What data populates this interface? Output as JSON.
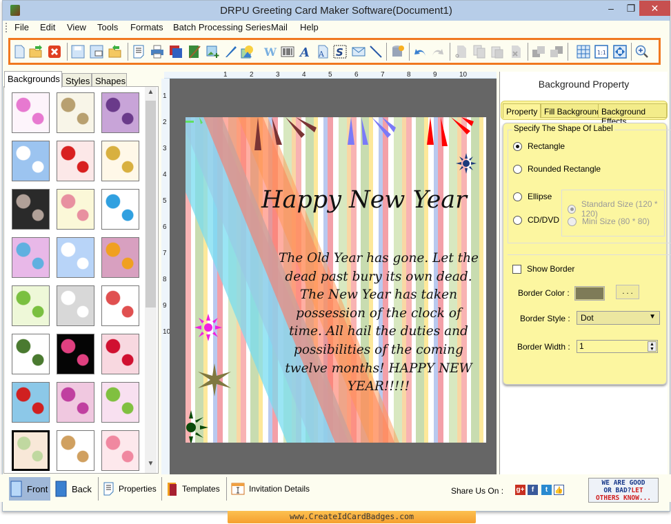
{
  "window": {
    "title": "DRPU Greeting Card Maker Software(Document1)",
    "controls": {
      "minimize": "‒",
      "maximize": "❐",
      "close": "✕"
    }
  },
  "menu": [
    "File",
    "Edit",
    "View",
    "Tools",
    "Formats",
    "Batch Processing Series",
    "Mail",
    "Help"
  ],
  "toolbar": {
    "tools": [
      "new",
      "open",
      "close",
      "save",
      "save-as",
      "export",
      "properties",
      "print",
      "background",
      "card-front",
      "insert-image",
      "pen",
      "shapes",
      "watermark",
      "barcode",
      "text",
      "word-art",
      "signature",
      "email",
      "line",
      "database",
      "undo",
      "redo",
      "cut",
      "copy",
      "paste",
      "delete",
      "bring-forward",
      "send-backward",
      "grid",
      "actual-size",
      "fit-to-window",
      "zoom-in"
    ]
  },
  "left_panel": {
    "tabs": [
      "Backgrounds",
      "Styles",
      "Shapes"
    ],
    "active_tab": "Backgrounds",
    "thumbnails": [
      {
        "name": "baby-items",
        "colors": [
          "#fdf4fb",
          "#e779d0"
        ]
      },
      {
        "name": "baby-sketches",
        "colors": [
          "#f8f5e8",
          "#b8a070"
        ]
      },
      {
        "name": "purple-flowers",
        "colors": [
          "#c8a4d8",
          "#6a3a8a"
        ]
      },
      {
        "name": "clouds",
        "colors": [
          "#9cc4f0",
          "#fff"
        ]
      },
      {
        "name": "strawberries",
        "colors": [
          "#fce8e8",
          "#d82020"
        ]
      },
      {
        "name": "autumn-leaves",
        "colors": [
          "#fff8e8",
          "#d8b040"
        ]
      },
      {
        "name": "dark-leaves",
        "colors": [
          "#2a2a2a",
          "#b0a098"
        ]
      },
      {
        "name": "flower-rows",
        "colors": [
          "#fbf8d8",
          "#e890a0"
        ]
      },
      {
        "name": "gift-boxes",
        "colors": [
          "#ffffff",
          "#30a0e0"
        ]
      },
      {
        "name": "colorful-circles",
        "colors": [
          "#e8b8e8",
          "#60b0e0"
        ]
      },
      {
        "name": "snowflakes",
        "colors": [
          "#b8d4f8",
          "#ffffff"
        ]
      },
      {
        "name": "mandala-circles",
        "colors": [
          "#d8a0c0",
          "#f0a020"
        ]
      },
      {
        "name": "christmas-trees",
        "colors": [
          "#eef8d8",
          "#7ac040"
        ]
      },
      {
        "name": "white-heart",
        "colors": [
          "#d8d8d8",
          "#ffffff"
        ]
      },
      {
        "name": "kids-pattern",
        "colors": [
          "#ffffff",
          "#e05050"
        ]
      },
      {
        "name": "hearts-ornament",
        "colors": [
          "#ffffff",
          "#4a7a30"
        ]
      },
      {
        "name": "fireworks",
        "colors": [
          "#050505",
          "#e04080"
        ]
      },
      {
        "name": "red-hearts",
        "colors": [
          "#f8d8e0",
          "#d01030"
        ]
      },
      {
        "name": "santa-pattern",
        "colors": [
          "#8cc8e8",
          "#d02020"
        ]
      },
      {
        "name": "pink-bubbles",
        "colors": [
          "#f0c8e0",
          "#c040a0"
        ]
      },
      {
        "name": "pink-flowers",
        "colors": [
          "#f8e0f0",
          "#80c040"
        ]
      },
      {
        "name": "pastel-stripes",
        "colors": [
          "#f8e8d8",
          "#c0d8a0"
        ]
      },
      {
        "name": "teddy-bear",
        "colors": [
          "#ffffff",
          "#d0a060"
        ]
      },
      {
        "name": "princess-pattern",
        "colors": [
          "#fde8ec",
          "#f088a0"
        ]
      }
    ],
    "selected_index": 21
  },
  "rulers": {
    "horizontal": [
      "1",
      "2",
      "3",
      "4",
      "5",
      "6",
      "7",
      "8",
      "9",
      "10"
    ],
    "vertical": [
      "1",
      "2",
      "3",
      "4",
      "5",
      "6",
      "7",
      "8",
      "9",
      "10"
    ]
  },
  "card": {
    "title": "Happy New Year",
    "body": "The Old Year has gone. Let the dead past bury its own dead. The New Year has taken possession of the clock of time. All hail the duties and possibilities of the coming twelve months! HAPPY NEW YEAR!!!!!"
  },
  "right_panel": {
    "title": "Background Property",
    "tabs": [
      "Property",
      "Fill Background",
      "Background Effects"
    ],
    "active_tab": "Property",
    "shape_group_label": "Specify The Shape Of Label",
    "shapes": [
      {
        "label": "Rectangle",
        "checked": true
      },
      {
        "label": "Rounded Rectangle",
        "checked": false
      },
      {
        "label": "Ellipse",
        "checked": false
      },
      {
        "label": "CD/DVD",
        "checked": false
      }
    ],
    "cd_sizes": [
      {
        "label": "Standard Size (120 * 120)",
        "checked": true,
        "disabled": true
      },
      {
        "label": "Mini Size (80 * 80)",
        "checked": false,
        "disabled": true
      }
    ],
    "show_border_label": "Show Border",
    "show_border_checked": false,
    "border_color_label": "Border Color :",
    "border_color": "#7e7b58",
    "browse_label": ". . .",
    "border_style_label": "Border Style :",
    "border_style_value": "Dot",
    "border_width_label": "Border Width :",
    "border_width_value": "1"
  },
  "bottom_bar": {
    "items": [
      "Front",
      "Back",
      "Properties",
      "Templates",
      "Invitation Details"
    ],
    "active": "Front",
    "share_label": "Share Us On :",
    "social": [
      "google-plus",
      "facebook",
      "twitter",
      "like"
    ],
    "feedback": {
      "line1": "WE ARE GOOD",
      "line2a": "OR BAD?",
      "line2b": "LET",
      "line3": "OTHERS KNOW..."
    }
  },
  "footer_url": "www.CreateIdCardBadges.com",
  "colors": {
    "accent_orange": "#f07820",
    "panel_yellow": "#fcf6a0",
    "canvas_gray": "#666666",
    "title_blue": "#b7cde8",
    "close_red": "#c7504f"
  }
}
